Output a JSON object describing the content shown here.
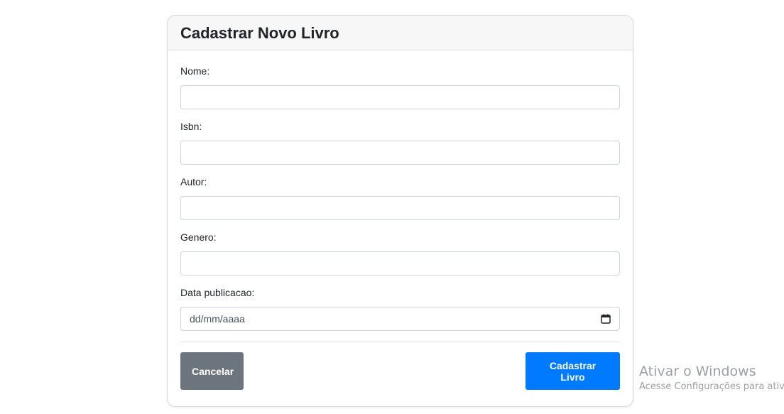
{
  "form": {
    "title": "Cadastrar Novo Livro",
    "fields": [
      {
        "label": "Nome:",
        "value": ""
      },
      {
        "label": "Isbn:",
        "value": ""
      },
      {
        "label": "Autor:",
        "value": ""
      },
      {
        "label": "Genero:",
        "value": ""
      },
      {
        "label": "Data publicacao:",
        "placeholder": "dd/mm/aaaa"
      }
    ],
    "cancel_label": "Cancelar",
    "submit_label": "Cadastrar Livro"
  },
  "watermark": {
    "title": "Ativar o Windows",
    "subtitle": "Acesse Configurações para ativ"
  },
  "colors": {
    "cancel_button": "#6c757d",
    "submit_button": "#007bff",
    "header_bg": "#f7f7f7"
  },
  "icons": {
    "date_picker": "calendar-icon"
  }
}
